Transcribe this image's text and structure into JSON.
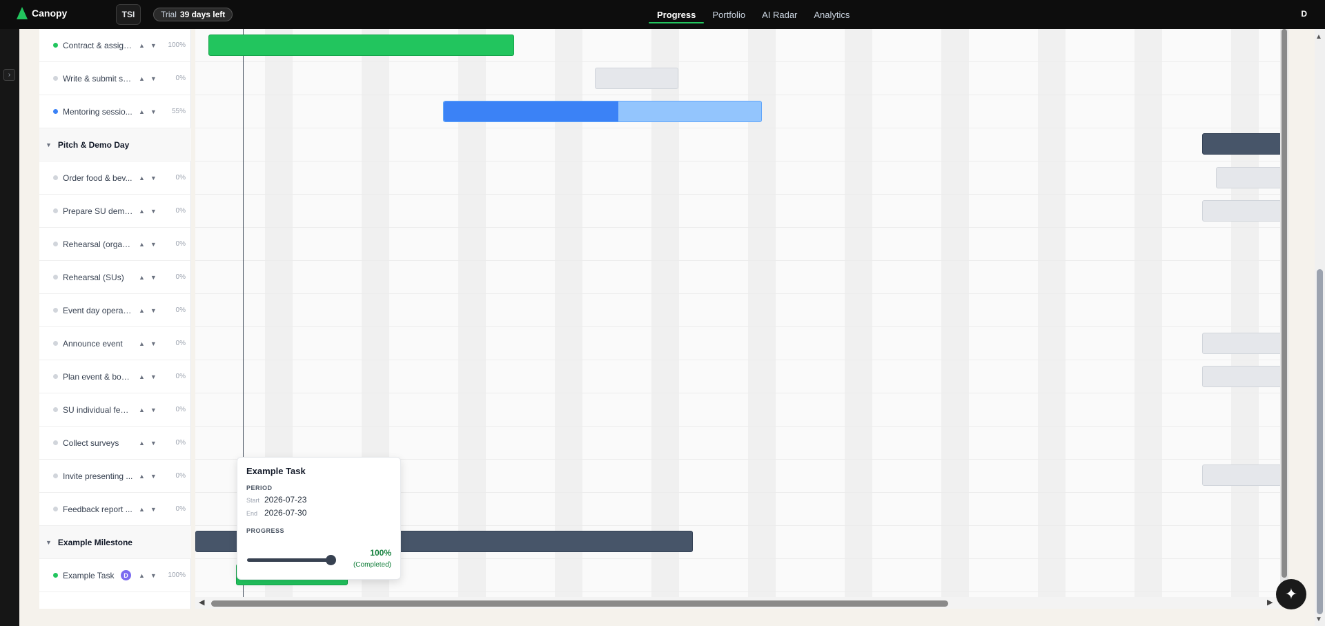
{
  "app": {
    "name": "Canopy",
    "workspace": "TSI",
    "trial_label": "Trial",
    "trial_days": "39 days left",
    "user_initial": "D"
  },
  "nav": {
    "tabs": [
      "Progress",
      "Portfolio",
      "AI Radar",
      "Analytics"
    ],
    "active": "Progress"
  },
  "tasks": [
    {
      "type": "task",
      "name": "Contract & assign...",
      "progress": "100%",
      "status_color": "#22c55e"
    },
    {
      "type": "task",
      "name": "Write & submit se...",
      "progress": "0%",
      "status_color": "#d1d5db"
    },
    {
      "type": "task",
      "name": "Mentoring sessio...",
      "progress": "55%",
      "status_color": "#3b82f6"
    },
    {
      "type": "group",
      "name": "Pitch & Demo Day"
    },
    {
      "type": "task",
      "name": "Order food & bev...",
      "progress": "0%",
      "status_color": "#d1d5db"
    },
    {
      "type": "task",
      "name": "Prepare SU demo...",
      "progress": "0%",
      "status_color": "#d1d5db"
    },
    {
      "type": "task",
      "name": "Rehearsal (organi...",
      "progress": "0%",
      "status_color": "#d1d5db"
    },
    {
      "type": "task",
      "name": "Rehearsal (SUs)",
      "progress": "0%",
      "status_color": "#d1d5db"
    },
    {
      "type": "task",
      "name": "Event day operati...",
      "progress": "0%",
      "status_color": "#d1d5db"
    },
    {
      "type": "task",
      "name": "Announce event",
      "progress": "0%",
      "status_color": "#d1d5db"
    },
    {
      "type": "task",
      "name": "Plan event & book...",
      "progress": "0%",
      "status_color": "#d1d5db"
    },
    {
      "type": "task",
      "name": "SU individual feed...",
      "progress": "0%",
      "status_color": "#d1d5db"
    },
    {
      "type": "task",
      "name": "Collect surveys",
      "progress": "0%",
      "status_color": "#d1d5db"
    },
    {
      "type": "task",
      "name": "Invite presenting ...",
      "progress": "0%",
      "status_color": "#d1d5db"
    },
    {
      "type": "task",
      "name": "Feedback report ...",
      "progress": "0%",
      "status_color": "#d1d5db"
    },
    {
      "type": "group",
      "name": "Example Milestone"
    },
    {
      "type": "task",
      "name": "Example Task",
      "progress": "100%",
      "status_color": "#22c55e",
      "assignee": "D"
    }
  ],
  "glyphs": {
    "up": "▲",
    "down": "▼",
    "collapse": "▼",
    "sidebar_toggle": "›",
    "fab": "✦",
    "left": "◀",
    "right": "▶",
    "up_small": "▲",
    "down_small": "▼"
  },
  "popup": {
    "title": "Example Task",
    "period_label": "PERIOD",
    "start_key": "Start",
    "start": "2026-07-23",
    "end_key": "End",
    "end": "2026-07-30",
    "progress_label": "PROGRESS",
    "progress_value": "100%",
    "progress_status": "(Completed)",
    "progress_fraction": 1.0
  }
}
